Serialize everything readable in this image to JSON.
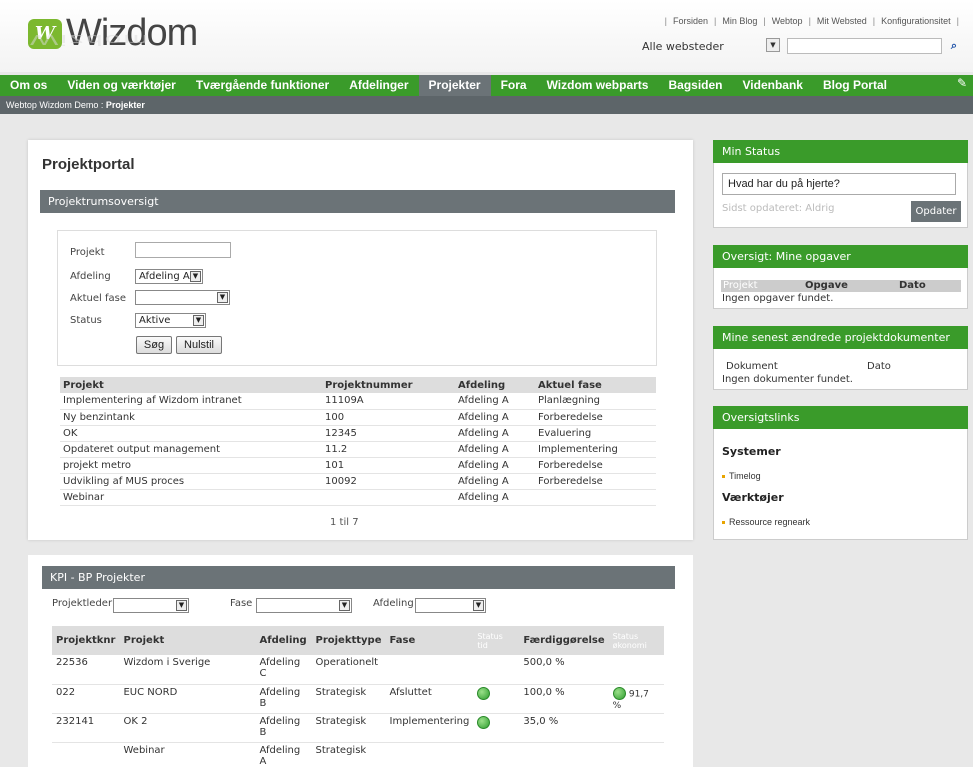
{
  "header": {
    "logo_mark": "W",
    "logo_text": "Wizdom",
    "logo_reflection": "Wizdom",
    "toplinks": [
      "Forsiden",
      "Min Blog",
      "Webtop",
      "Mit Websted",
      "Konfigurationsitet"
    ],
    "site_selector": "Alle websteder",
    "search_placeholder": "",
    "search_icon": "search-icon"
  },
  "nav": {
    "items": [
      "Om os",
      "Viden og værktøjer",
      "Tværgående funktioner",
      "Afdelinger",
      "Projekter",
      "Fora",
      "Wizdom webparts",
      "Bagsiden",
      "Videnbank",
      "Blog Portal"
    ],
    "active": "Projekter",
    "icon": "tags-icon"
  },
  "breadcrumb": {
    "parent": "Webtop Wizdom Demo",
    "separator": " : ",
    "current": "Projekter"
  },
  "main": {
    "title": "Projektportal",
    "overview_header": "Projektrumsoversigt",
    "filter": {
      "project_label": "Projekt",
      "project_value": "",
      "department_label": "Afdeling",
      "department_value": "Afdeling A",
      "phase_label": "Aktuel fase",
      "phase_value": "",
      "status_label": "Status",
      "status_value": "Aktive",
      "search_button": "Søg",
      "reset_button": "Nulstil"
    },
    "table": {
      "headers": [
        "Projekt",
        "Projektnummer",
        "Afdeling",
        "Aktuel fase"
      ],
      "rows": [
        [
          "Implementering af Wizdom intranet",
          "11109A",
          "Afdeling A",
          "Planlægning"
        ],
        [
          "Ny benzintank",
          "100",
          "Afdeling A",
          "Forberedelse"
        ],
        [
          "OK",
          "12345",
          "Afdeling A",
          "Evaluering"
        ],
        [
          "Opdateret output management",
          "11.2",
          "Afdeling A",
          "Implementering"
        ],
        [
          "projekt metro",
          "101",
          "Afdeling A",
          "Forberedelse"
        ],
        [
          "Udvikling af MUS proces",
          "10092",
          "Afdeling A",
          "Forberedelse"
        ],
        [
          "Webinar",
          "",
          "Afdeling A",
          ""
        ]
      ]
    },
    "paging": "1 til 7"
  },
  "kpi": {
    "header": "KPI - BP Projekter",
    "filters": {
      "leader_label": "Projektleder",
      "phase_label": "Fase",
      "department_label": "Afdeling"
    },
    "headers": [
      "Projektknr",
      "Projekt",
      "Afdeling",
      "Projekttype",
      "Fase",
      "Status tid",
      "Færdiggørelse",
      "Status økonomi"
    ],
    "rows": [
      {
        "nr": "22536",
        "project": "Wizdom i Sverige",
        "dept": "Afdeling C",
        "type": "Operationelt",
        "phase": "",
        "time_status": false,
        "completion": "500,0 %",
        "economy_status": false,
        "economy": ""
      },
      {
        "nr": "022",
        "project": "EUC NORD",
        "dept": "Afdeling B",
        "type": "Strategisk",
        "phase": "Afsluttet",
        "time_status": true,
        "completion": "100,0 %",
        "economy_status": true,
        "economy": "91,7 %"
      },
      {
        "nr": "232141",
        "project": "OK 2",
        "dept": "Afdeling B",
        "type": "Strategisk",
        "phase": "Implementering",
        "time_status": true,
        "completion": "35,0 %",
        "economy_status": false,
        "economy": ""
      },
      {
        "nr": "",
        "project": "Webinar",
        "dept": "Afdeling A",
        "type": "Strategisk",
        "phase": "",
        "time_status": false,
        "completion": "",
        "economy_status": false,
        "economy": ""
      }
    ],
    "status_color": "#2f9e2f"
  },
  "sidebar": {
    "status": {
      "header": "Min Status",
      "input_value": "Hvad har du på hjerte?",
      "last_updated": "Sidst opdateret: Aldrig",
      "update_button": "Opdater"
    },
    "tasks": {
      "header": "Oversigt: Mine opgaver",
      "col_project": "Projekt",
      "col_task": "Opgave",
      "col_date": "Dato",
      "empty": "Ingen opgaver fundet."
    },
    "documents": {
      "header": "Mine senest ændrede projektdokumenter",
      "col_document": "Dokument",
      "col_date": "Dato",
      "empty": "Ingen dokumenter fundet."
    },
    "links": {
      "header": "Oversigtslinks",
      "groups": [
        {
          "title": "Systemer",
          "items": [
            "Timelog"
          ]
        },
        {
          "title": "Værktøjer",
          "items": [
            "Ressource regneark"
          ]
        }
      ]
    }
  },
  "colors": {
    "brand_green": "#3a9b2a",
    "nav_gray": "#6b7377"
  }
}
